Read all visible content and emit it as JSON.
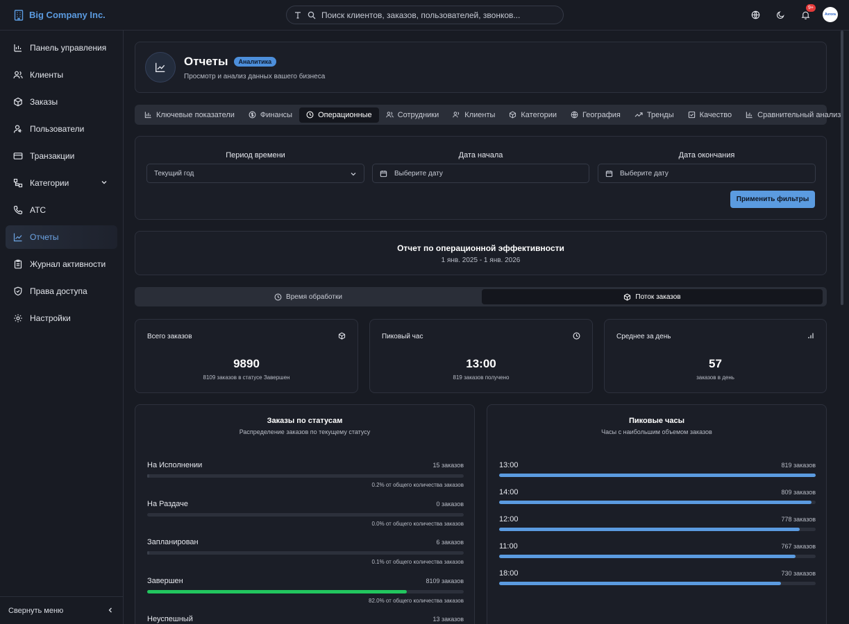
{
  "brand": {
    "name": "Big Company Inc."
  },
  "search": {
    "placeholder": "Поиск клиентов, заказов, пользователей, звонков..."
  },
  "topbar": {
    "notifications_badge": "9+",
    "avatar_text": "Avrora"
  },
  "sidebar": {
    "items": [
      {
        "label": "Панель управления",
        "icon": "dashboard-icon"
      },
      {
        "label": "Клиенты",
        "icon": "users-icon"
      },
      {
        "label": "Заказы",
        "icon": "package-icon"
      },
      {
        "label": "Пользователи",
        "icon": "user-settings-icon"
      },
      {
        "label": "Транзакции",
        "icon": "credit-card-icon"
      },
      {
        "label": "Категории",
        "icon": "categories-icon"
      },
      {
        "label": "АТС",
        "icon": "phone-icon"
      },
      {
        "label": "Отчеты",
        "icon": "chart-line-icon"
      },
      {
        "label": "Журнал активности",
        "icon": "clipboard-icon"
      },
      {
        "label": "Права доступа",
        "icon": "shield-icon"
      },
      {
        "label": "Настройки",
        "icon": "gear-icon"
      }
    ],
    "collapse_label": "Свернуть меню"
  },
  "header": {
    "title": "Отчеты",
    "badge": "Аналитика",
    "subtitle": "Просмотр и анализ данных вашего бизнеса"
  },
  "tabs": [
    {
      "label": "Ключевые показатели"
    },
    {
      "label": "Финансы"
    },
    {
      "label": "Операционные"
    },
    {
      "label": "Сотрудники"
    },
    {
      "label": "Клиенты"
    },
    {
      "label": "Категории"
    },
    {
      "label": "География"
    },
    {
      "label": "Тренды"
    },
    {
      "label": "Качество"
    },
    {
      "label": "Сравнительный анализ"
    }
  ],
  "filters": {
    "period_label": "Период времени",
    "period_value": "Текущий год",
    "start_label": "Дата начала",
    "start_placeholder": "Выберите дату",
    "end_label": "Дата окончания",
    "end_placeholder": "Выберите дату",
    "apply_label": "Применить фильтры"
  },
  "report": {
    "title": "Отчет по операционной эффективности",
    "range": "1 янв. 2025 - 1 янв. 2026"
  },
  "subtabs": [
    {
      "label": "Время обработки"
    },
    {
      "label": "Поток заказов"
    }
  ],
  "kpis": [
    {
      "label": "Всего заказов",
      "value": "9890",
      "sub": "8109 заказов в статусе Завершен"
    },
    {
      "label": "Пиковый час",
      "value": "13:00",
      "sub": "819 заказов получено"
    },
    {
      "label": "Среднее за день",
      "value": "57",
      "sub": "заказов в день"
    }
  ],
  "status_panel": {
    "title": "Заказы по статусам",
    "subtitle": "Распределение заказов по текущему статусу",
    "rows": [
      {
        "name": "На Исполнении",
        "count": "15 заказов",
        "pct_text": "0.2% от общего количества заказов",
        "fraction": 0.002,
        "color": "#3a3f4b"
      },
      {
        "name": "На Раздаче",
        "count": "0 заказов",
        "pct_text": "0.0% от общего количества заказов",
        "fraction": 0.0,
        "color": "#3a3f4b"
      },
      {
        "name": "Запланирован",
        "count": "6 заказов",
        "pct_text": "0.1% от общего количества заказов",
        "fraction": 0.001,
        "color": "#3a3f4b"
      },
      {
        "name": "Завершен",
        "count": "8109 заказов",
        "pct_text": "82.0% от общего количества заказов",
        "fraction": 0.82,
        "color": "#22c55e"
      },
      {
        "name": "Неуспешный",
        "count": "13 заказов",
        "pct_text": "",
        "fraction": 0.001,
        "color": "#3a3f4b"
      }
    ]
  },
  "peak_panel": {
    "title": "Пиковые часы",
    "subtitle": "Часы с наибольшим объемом заказов",
    "rows": [
      {
        "hour": "13:00",
        "count": "819 заказов",
        "value": 819
      },
      {
        "hour": "14:00",
        "count": "809 заказов",
        "value": 809
      },
      {
        "hour": "12:00",
        "count": "778 заказов",
        "value": 778
      },
      {
        "hour": "11:00",
        "count": "767 заказов",
        "value": 767
      },
      {
        "hour": "18:00",
        "count": "730 заказов",
        "value": 730
      }
    ],
    "max": 819
  }
}
